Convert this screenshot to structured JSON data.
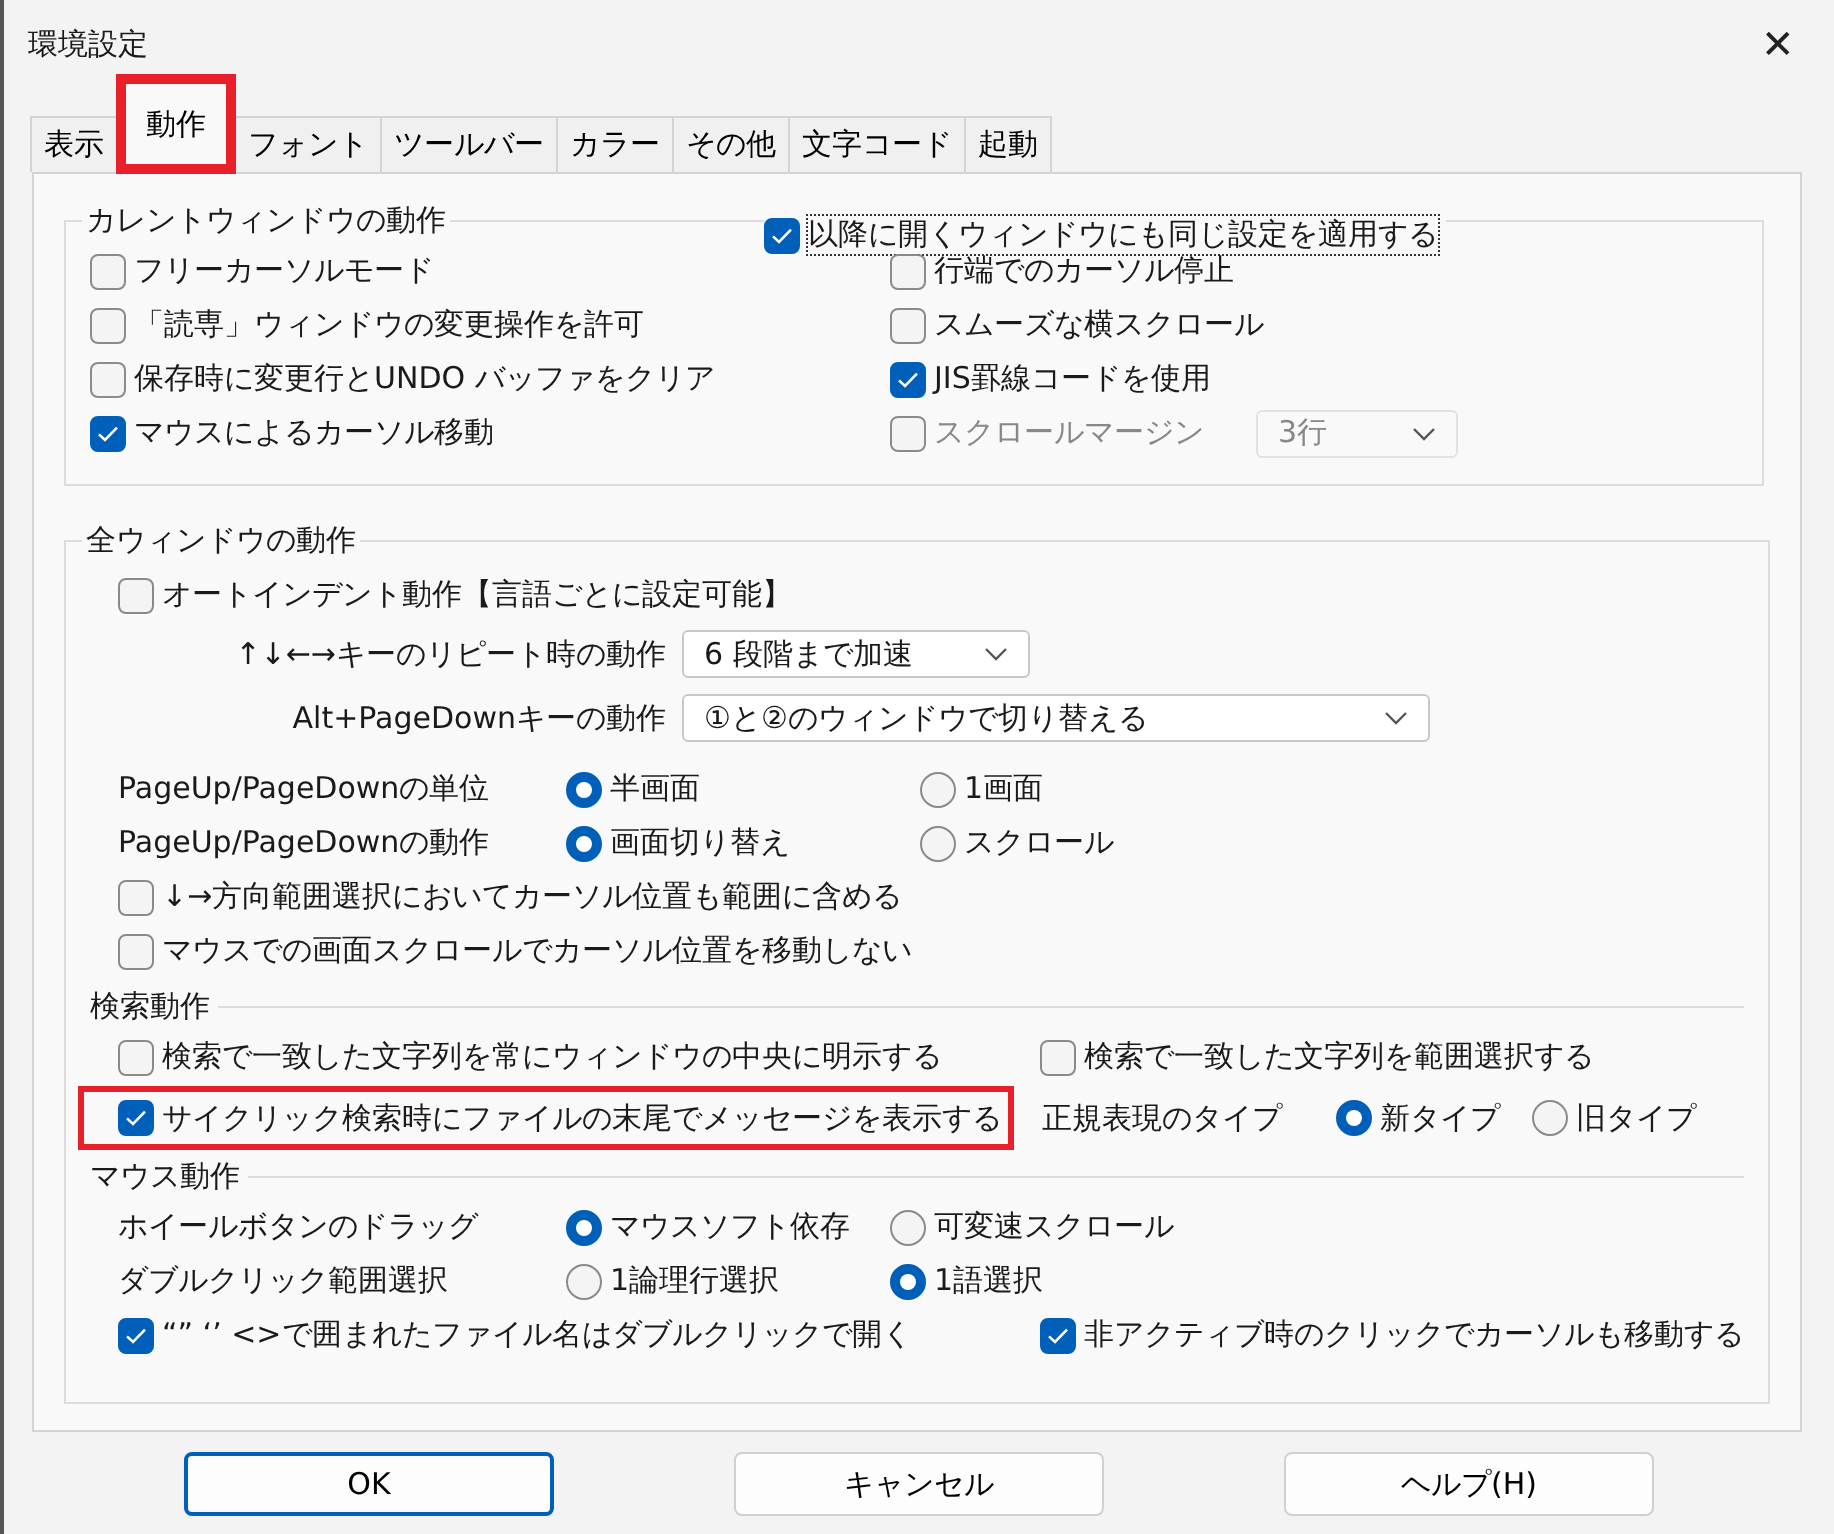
{
  "window": {
    "title": "環境設定",
    "close": "✕"
  },
  "tabs": [
    {
      "label": "表示",
      "selected": false,
      "highlighted": false
    },
    {
      "label": "動作",
      "selected": true,
      "highlighted": true
    },
    {
      "label": "フォント",
      "selected": false,
      "highlighted": false
    },
    {
      "label": "ツールバー",
      "selected": false,
      "highlighted": false
    },
    {
      "label": "カラー",
      "selected": false,
      "highlighted": false
    },
    {
      "label": "その他",
      "selected": false,
      "highlighted": false
    },
    {
      "label": "文字コード",
      "selected": false,
      "highlighted": false
    },
    {
      "label": "起動",
      "selected": false,
      "highlighted": false
    }
  ],
  "current_window": {
    "title": "カレントウィンドウの動作",
    "apply_all": {
      "label": "以降に開くウィンドウにも同じ設定を適用する",
      "checked": true
    },
    "left": [
      {
        "kind": "checkbox",
        "label": "フリーカーソルモード",
        "checked": false
      },
      {
        "kind": "checkbox",
        "label": "「読専」ウィンドウの変更操作を許可",
        "checked": false
      },
      {
        "kind": "checkbox",
        "label": "保存時に変更行とUNDO バッファをクリア",
        "checked": false
      },
      {
        "kind": "checkbox",
        "label": "マウスによるカーソル移動",
        "checked": true
      }
    ],
    "right": [
      {
        "kind": "checkbox",
        "label": "行端でのカーソル停止",
        "checked": false
      },
      {
        "kind": "checkbox",
        "label": "スムーズな横スクロール",
        "checked": false
      },
      {
        "kind": "checkbox",
        "label": "JIS罫線コードを使用",
        "checked": true
      },
      {
        "kind": "checkbox_select",
        "label": "スクロールマージン",
        "checked": false,
        "value": "3行",
        "disabled": true
      }
    ]
  },
  "all_windows": {
    "title": "全ウィンドウの動作",
    "auto_indent": {
      "label": "オートインデント動作【言語ごとに設定可能】",
      "checked": false
    },
    "selects": [
      {
        "label": "↑↓←→キーのリピート時の動作",
        "value": "6 段階まで加速"
      },
      {
        "label": "Alt+PageDownキーの動作",
        "value": "①と②のウィンドウで切り替える"
      }
    ],
    "radio_rows": [
      {
        "label": "PageUp/PageDownの単位",
        "options": [
          {
            "label": "半画面",
            "selected": true
          },
          {
            "label": "1画面",
            "selected": false
          }
        ]
      },
      {
        "label": "PageUp/PageDownの動作",
        "options": [
          {
            "label": "画面切り替え",
            "selected": true
          },
          {
            "label": "スクロール",
            "selected": false
          }
        ]
      }
    ],
    "checks": [
      {
        "label": "↓→方向範囲選択においてカーソル位置も範囲に含める",
        "checked": false
      },
      {
        "label": "マウスでの画面スクロールでカーソル位置を移動しない",
        "checked": false
      }
    ]
  },
  "search": {
    "title": "検索動作",
    "checks": [
      {
        "label": "検索で一致した文字列を常にウィンドウの中央に明示する",
        "checked": false
      },
      {
        "label": "検索で一致した文字列を範囲選択する",
        "checked": false
      },
      {
        "label": "サイクリック検索時にファイルの末尾でメッセージを表示する",
        "checked": true,
        "highlighted": true
      }
    ],
    "regex": {
      "label": "正規表現のタイプ",
      "options": [
        {
          "label": "新タイプ",
          "selected": true
        },
        {
          "label": "旧タイプ",
          "selected": false
        }
      ]
    }
  },
  "mouse": {
    "title": "マウス動作",
    "radio_rows": [
      {
        "label": "ホイールボタンのドラッグ",
        "options": [
          {
            "label": "マウスソフト依存",
            "selected": true
          },
          {
            "label": "可変速スクロール",
            "selected": false
          }
        ]
      },
      {
        "label": "ダブルクリック範囲選択",
        "options": [
          {
            "label": "1論理行選択",
            "selected": false
          },
          {
            "label": "1語選択",
            "selected": true
          }
        ]
      }
    ],
    "checks": [
      {
        "label": "“” ‘’ <>で囲まれたファイル名はダブルクリックで開く",
        "checked": true
      },
      {
        "label": "非アクティブ時のクリックでカーソルも移動する",
        "checked": true
      }
    ]
  },
  "buttons": [
    {
      "label": "OK",
      "default": true
    },
    {
      "label": "キャンセル",
      "default": false
    },
    {
      "label": "ヘルプ(H)",
      "default": false
    }
  ]
}
